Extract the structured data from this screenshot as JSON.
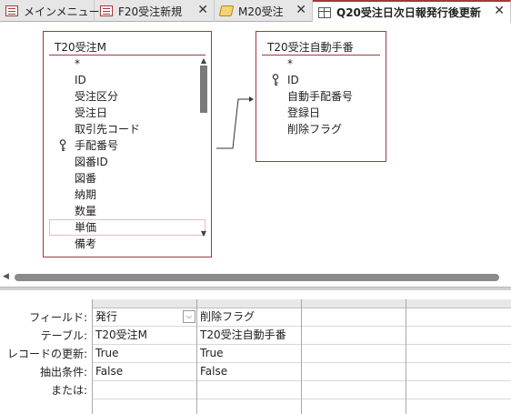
{
  "tabs": [
    {
      "label": "メインメニュー",
      "icon": "form-icon"
    },
    {
      "label": "F20受注新規",
      "icon": "form-icon"
    },
    {
      "label": "M20受注",
      "icon": "macro-icon"
    },
    {
      "label": "Q20受注日次日報発行後更新",
      "icon": "query-icon",
      "active": true
    }
  ],
  "close_glyph": "✕",
  "tables": {
    "left": {
      "title": "T20受注M",
      "fields": [
        "*",
        "ID",
        "受注区分",
        "受注日",
        "取引先コード",
        "手配番号",
        "図番ID",
        "図番",
        "納期",
        "数量",
        "単価",
        "備考"
      ],
      "key_field_index": 5,
      "selected_field_index": 10
    },
    "right": {
      "title": "T20受注自動手番",
      "fields": [
        "*",
        "ID",
        "自動手配番号",
        "登録日",
        "削除フラグ"
      ],
      "key_field_index": 1
    }
  },
  "grid": {
    "row_labels": [
      "フィールド:",
      "テーブル:",
      "レコードの更新:",
      "抽出条件:",
      "または:"
    ],
    "columns": [
      {
        "field": "発行",
        "table": "T20受注M",
        "update": "True",
        "criteria": "False",
        "or": "",
        "has_dropdown": true
      },
      {
        "field": "削除フラグ",
        "table": "T20受注自動手番",
        "update": "True",
        "criteria": "False",
        "or": ""
      },
      {
        "field": "",
        "table": "",
        "update": "",
        "criteria": "",
        "or": ""
      },
      {
        "field": "",
        "table": "",
        "update": "",
        "criteria": "",
        "or": ""
      }
    ]
  },
  "colors": {
    "accent": "#a4373a",
    "scroll_thumb": "#7a7a7a"
  }
}
